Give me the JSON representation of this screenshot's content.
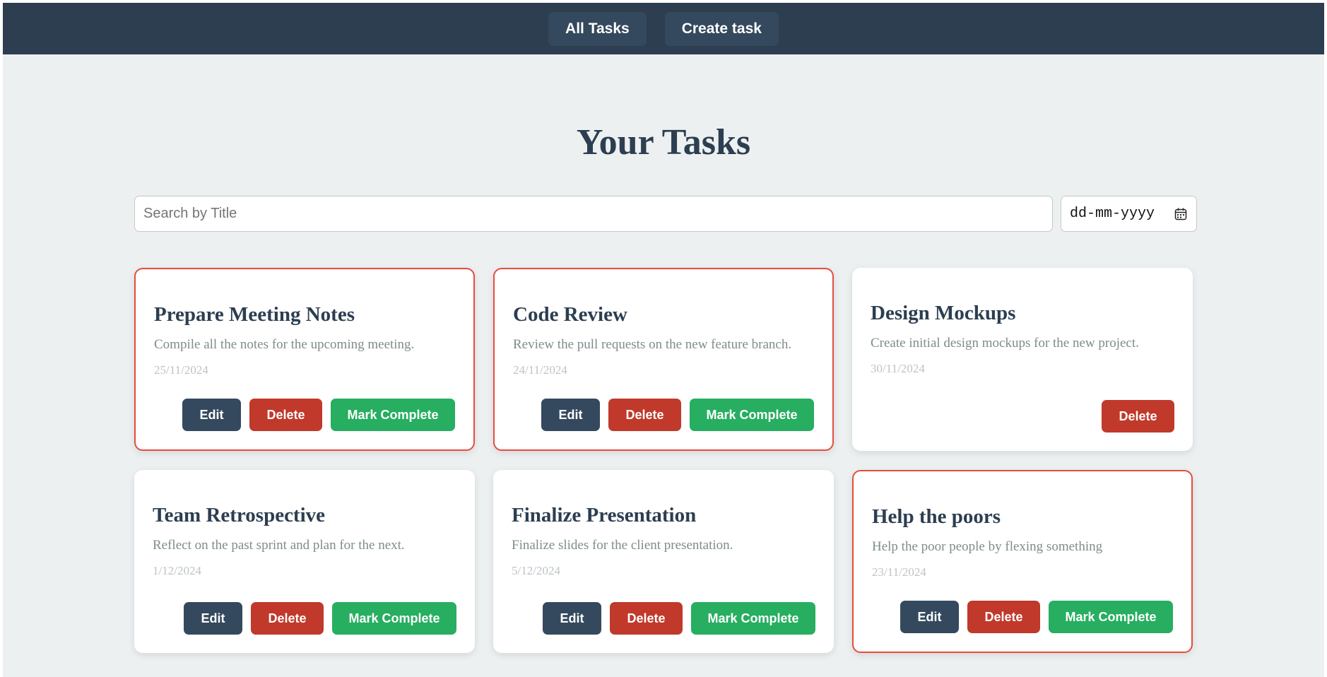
{
  "nav": {
    "all_tasks_label": "All Tasks",
    "create_task_label": "Create task"
  },
  "page_title": "Your Tasks",
  "search": {
    "value": "",
    "placeholder": "Search by Title"
  },
  "date_filter": {
    "placeholder": "dd-mm-yyyy",
    "icon": "calendar-icon"
  },
  "colors": {
    "navbar": "#2c3e50",
    "background": "#ecf0f1",
    "overdue_border": "#e74c3c",
    "edit": "#34495e",
    "delete": "#c0392b",
    "complete": "#27ae60"
  },
  "tasks": [
    {
      "title": "Prepare Meeting Notes",
      "description": "Compile all the notes for the upcoming meeting.",
      "date": "25/11/2024",
      "overdue": true,
      "completed": false,
      "edit_label": "Edit",
      "delete_label": "Delete",
      "complete_label": "Mark Complete"
    },
    {
      "title": "Code Review",
      "description": "Review the pull requests on the new feature branch.",
      "date": "24/11/2024",
      "overdue": true,
      "completed": false,
      "edit_label": "Edit",
      "delete_label": "Delete",
      "complete_label": "Mark Complete"
    },
    {
      "title": "Design Mockups",
      "description": "Create initial design mockups for the new project.",
      "date": "30/11/2024",
      "overdue": false,
      "completed": true,
      "delete_label": "Delete"
    },
    {
      "title": "Team Retrospective",
      "description": "Reflect on the past sprint and plan for the next.",
      "date": "1/12/2024",
      "overdue": false,
      "completed": false,
      "edit_label": "Edit",
      "delete_label": "Delete",
      "complete_label": "Mark Complete"
    },
    {
      "title": "Finalize Presentation",
      "description": "Finalize slides for the client presentation.",
      "date": "5/12/2024",
      "overdue": false,
      "completed": false,
      "edit_label": "Edit",
      "delete_label": "Delete",
      "complete_label": "Mark Complete"
    },
    {
      "title": "Help the poors",
      "description": "Help the poor people by flexing something",
      "date": "23/11/2024",
      "overdue": true,
      "completed": false,
      "edit_label": "Edit",
      "delete_label": "Delete",
      "complete_label": "Mark Complete"
    }
  ]
}
